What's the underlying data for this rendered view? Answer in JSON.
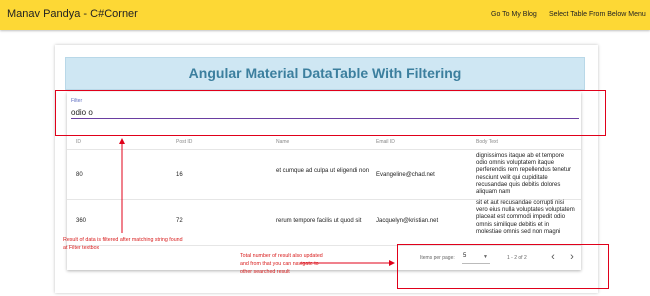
{
  "toolbar": {
    "brand": "Manav Pandya - C#Corner",
    "links": [
      "Go To My Blog",
      "Select Table From Below Menu"
    ]
  },
  "heading": "Angular Material DataTable With Filtering",
  "filter": {
    "label": "Filter",
    "value": "odio o"
  },
  "table": {
    "columns": [
      "ID",
      "Post ID",
      "Name",
      "Email ID",
      "Body Text"
    ],
    "rows": [
      {
        "id": "80",
        "post_id": "16",
        "name": "et cumque ad culpa ut eligendi non",
        "email": "Evangeline@chad.net",
        "body": "dignissimos itaque ab et tempore odio omnis voluptatem itaque perferendis rem repellendus tenetur nesciunt velit qui cupiditate recusandae quis debitis dolores aliquam nam"
      },
      {
        "id": "360",
        "post_id": "72",
        "name": "rerum tempore facilis ut quod sit",
        "email": "Jacquelyn@kristian.net",
        "body": "sit et aut recusandae corrupti nisi vero eius nulla voluptates voluptatem placeat est commodi impedit odio omnis similique debitis et in molestiae omnis sed non magni"
      }
    ]
  },
  "paginator": {
    "items_per_page_label": "Items per page:",
    "page_size": "5",
    "range": "1 - 2 of 2"
  },
  "annotations": {
    "filter_note": "Result of data is filtered after matching string found at Filter textbox",
    "paginator_note": "Total number of result also updated and from that you can navigate to other searched result"
  },
  "colors": {
    "toolbar": "#fdd835",
    "heading_bg": "#cfe7f3",
    "heading_text": "#3c7f9e",
    "annotation": "#e0001a"
  },
  "icons": [
    "chevron-left-icon",
    "chevron-right-icon",
    "dropdown-caret-icon"
  ]
}
